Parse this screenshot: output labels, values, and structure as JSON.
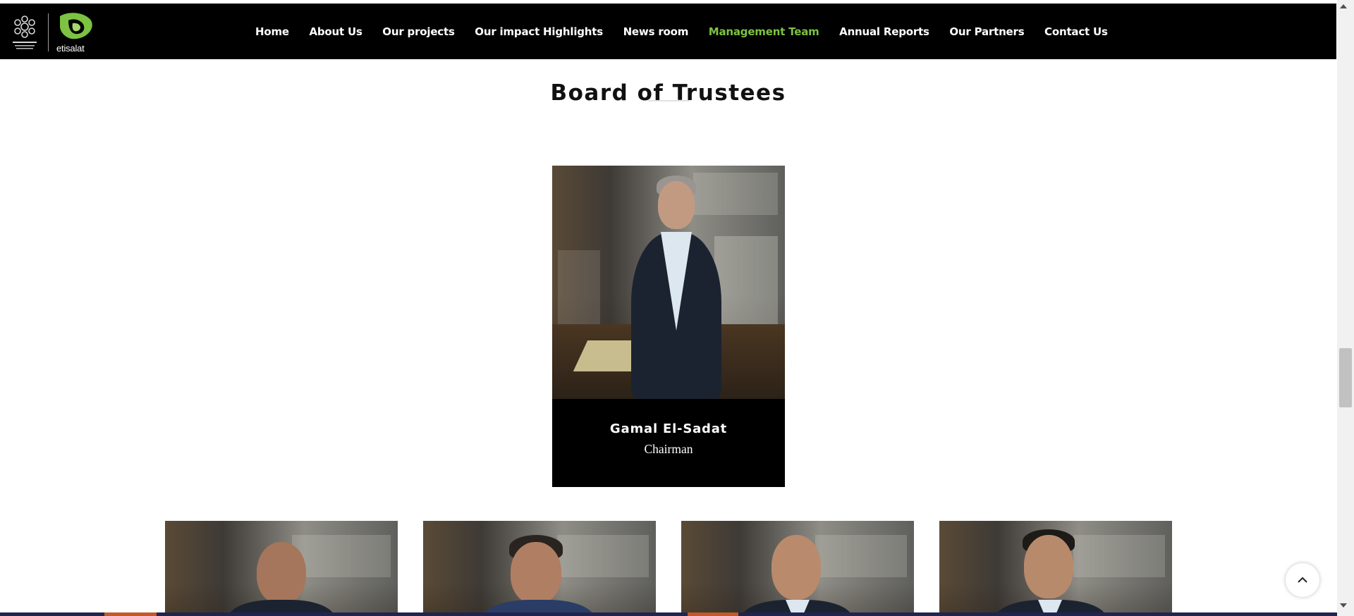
{
  "brand": {
    "wordmark": "etisalat",
    "accent_color": "#7dc242"
  },
  "nav": {
    "items": [
      {
        "label": "Home",
        "active": false
      },
      {
        "label": "About Us",
        "active": false
      },
      {
        "label": "Our projects",
        "active": false
      },
      {
        "label": "Our impact Highlights",
        "active": false
      },
      {
        "label": "News room",
        "active": false
      },
      {
        "label": "Management Team",
        "active": true
      },
      {
        "label": "Annual Reports",
        "active": false
      },
      {
        "label": "Our Partners",
        "active": false
      },
      {
        "label": "Contact Us",
        "active": false
      }
    ],
    "active_color": "#7dc242"
  },
  "section": {
    "title": "Board of Trustees"
  },
  "featured_member": {
    "name": "Gamal El-Sadat",
    "role": "Chairman"
  },
  "icons": {
    "back_to_top": "chevron-up-icon",
    "scroll_up": "triangle-up-icon",
    "scroll_down": "triangle-down-icon"
  }
}
